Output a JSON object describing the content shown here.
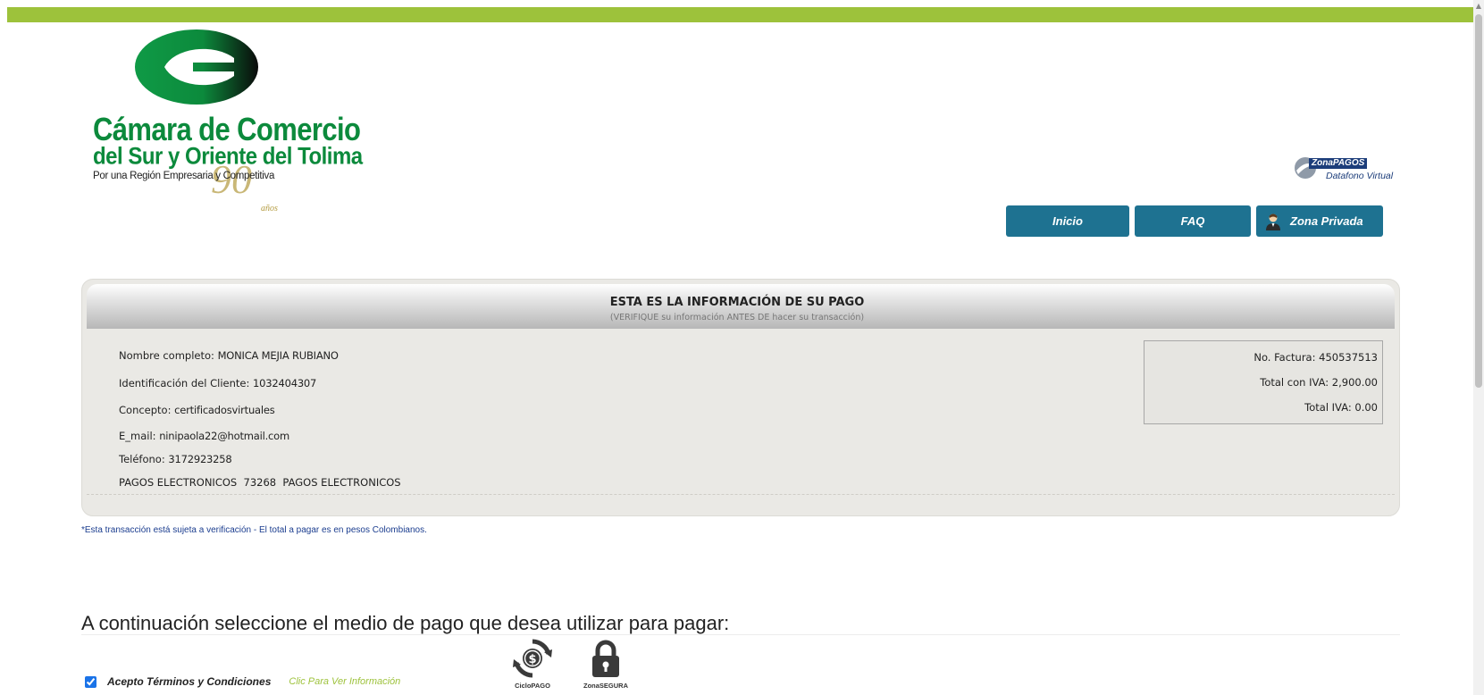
{
  "logo": {
    "line1": "Cámara de Comercio",
    "line2": "del Sur y Oriente del Tolima",
    "line3": "Por una Región Empresaria y Competitiva",
    "anniversary": "90",
    "anniversary_sub": "años"
  },
  "zonapagos": {
    "brand_zona": "Zona",
    "brand_pagos": "PAGOS",
    "subtitle": "Datafono Virtual"
  },
  "nav": {
    "inicio": "Inicio",
    "faq": "FAQ",
    "zona_privada": "Zona Privada"
  },
  "panel": {
    "title": "ESTA ES LA INFORMACIÓN DE SU PAGO",
    "subtitle": "(VERIFIQUE su información ANTES DE hacer su transacción)",
    "nombre_label": "Nombre completo:",
    "nombre_value": "MONICA MEJIA RUBIANO",
    "id_label": "Identificación del Cliente:",
    "id_value": "1032404307",
    "concepto_label": "Concepto:",
    "concepto_value": "certificadosvirtuales",
    "email_label": "E_mail:",
    "email_value": "ninipaola22@hotmail.com",
    "telefono_label": "Teléfono:",
    "telefono_value": "3172923258",
    "extra_line": "PAGOS ELECTRONICOS  73268  PAGOS ELECTRONICOS"
  },
  "invoice": {
    "factura": "No. Factura: 450537513",
    "total_iva": "Total con IVA: 2,900.00",
    "iva": "Total IVA: 0.00"
  },
  "note": "*Esta transacción está sujeta a verificación - El total a pagar es en pesos Colombianos.",
  "payment": {
    "title": "A continuación seleccione el medio de pago que desea utilizar para pagar:",
    "terms_label": "Acepto Términos y Condiciones",
    "terms_link": "Clic Para Ver Información",
    "terms_checked": true
  },
  "badges": {
    "ciclo": "CicloPAGO",
    "segura": "ZonaSEGURA"
  },
  "colors": {
    "top_bar": "#9dc23b",
    "nav_button": "#1e7291",
    "brand_green": "#0c8a3c",
    "link_green": "#9dc23b",
    "note_blue": "#1b3d8f"
  },
  "icons": {
    "user": "user-icon",
    "ciclo": "cycle-dollar-icon",
    "lock": "lock-icon",
    "logo": "chamber-logo-emblem"
  }
}
